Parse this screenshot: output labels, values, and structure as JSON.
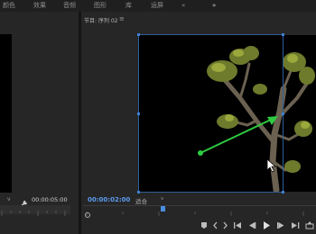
{
  "workspace_tabs": [
    "颜色",
    "效果",
    "音频",
    "图形",
    "库",
    "运屏",
    "«",
    "»"
  ],
  "source_monitor": {
    "tool_icon": "wrench-icon",
    "timecode": "00:00:05:00",
    "dropdown_indicator": "v"
  },
  "program_monitor": {
    "title": "节目: 序列 02",
    "menu_icon": "≡",
    "timecode": "00:00:02:00",
    "fit_label": "适合",
    "fit_caret": "v"
  },
  "playback_controls": [
    "marker-icon",
    "in-point-icon",
    "out-point-icon",
    "go-to-in-icon",
    "step-back-icon",
    "play-icon",
    "step-forward-icon",
    "go-to-out-icon",
    "lift-icon"
  ],
  "annotation_arrow": {
    "color": "#2ecc40"
  },
  "colors": {
    "accent_blue": "#4a8ee0",
    "panel_bg": "#262626",
    "timecode": "#5b9bf0"
  }
}
